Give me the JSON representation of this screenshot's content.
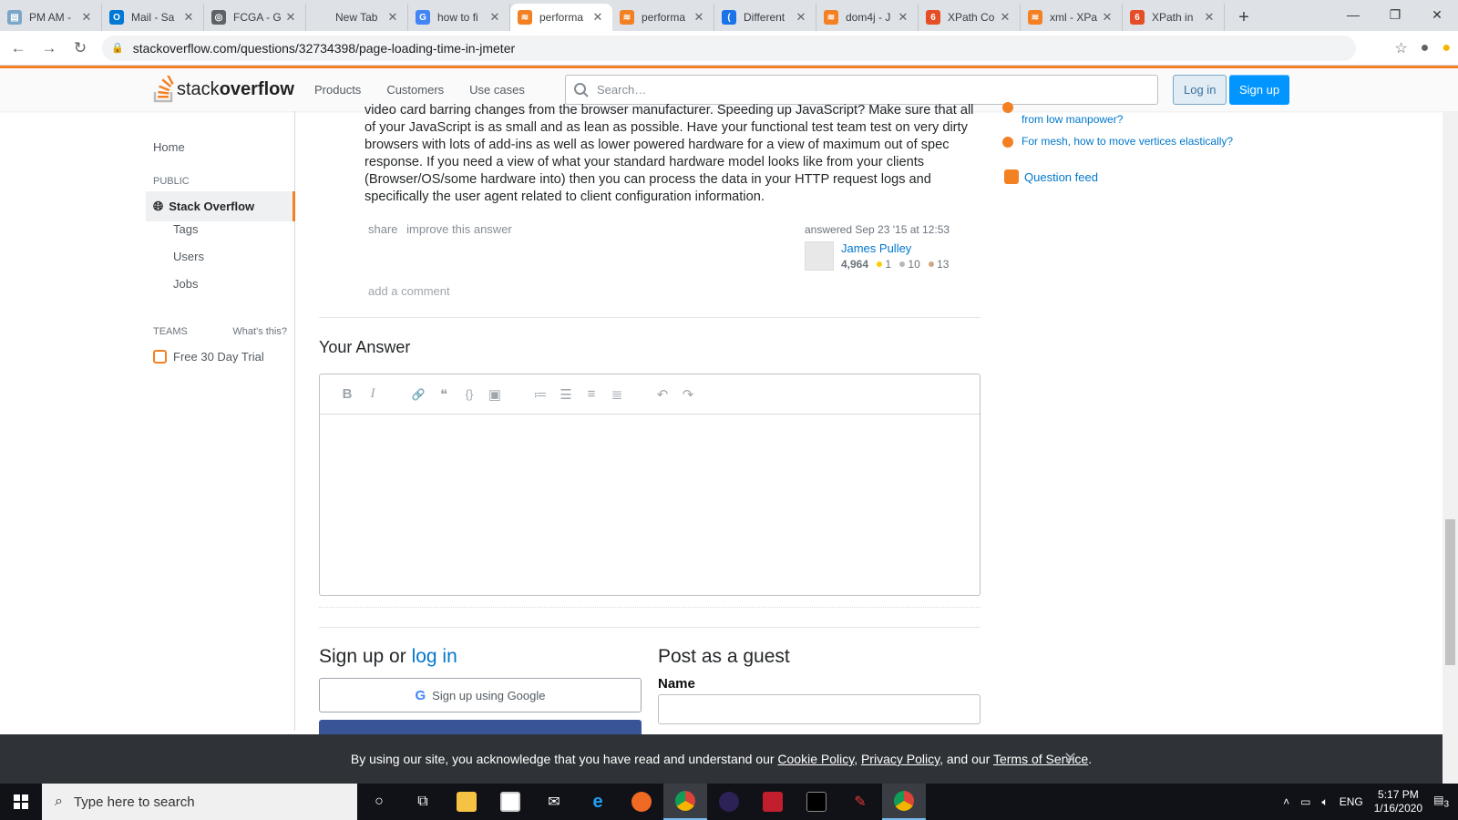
{
  "browser": {
    "tabs": [
      {
        "title": "PM AM -",
        "color": "#7aa7c7",
        "glyph": "▤"
      },
      {
        "title": "Mail - Sa",
        "color": "#0078d4",
        "glyph": "O"
      },
      {
        "title": "FCGA - G",
        "color": "#5f6368",
        "glyph": "◎"
      },
      {
        "title": "New Tab",
        "color": "",
        "glyph": ""
      },
      {
        "title": "how to fi",
        "color": "#4285f4",
        "glyph": "G"
      },
      {
        "title": "performa",
        "color": "#f48024",
        "glyph": "≋",
        "active": true
      },
      {
        "title": "performa",
        "color": "#f48024",
        "glyph": "≋"
      },
      {
        "title": "Different",
        "color": "#1a73e8",
        "glyph": "("
      },
      {
        "title": "dom4j - J",
        "color": "#f48024",
        "glyph": "≋"
      },
      {
        "title": "XPath Co",
        "color": "#e44d26",
        "glyph": "6"
      },
      {
        "title": "xml - XPa",
        "color": "#f48024",
        "glyph": "≋"
      },
      {
        "title": "XPath in",
        "color": "#e44d26",
        "glyph": "6"
      }
    ],
    "new_tab_glyph": "+",
    "window_controls": {
      "minimize": "—",
      "restore": "❐",
      "close": "✕"
    },
    "url": "stackoverflow.com/questions/32734398/page-loading-time-in-jmeter"
  },
  "so_header": {
    "logo_stack": "stack",
    "logo_overflow": "overflow",
    "nav": [
      "Products",
      "Customers",
      "Use cases"
    ],
    "search_placeholder": "Search…",
    "login": "Log in",
    "signup": "Sign up"
  },
  "left_nav": {
    "home": "Home",
    "public": "PUBLIC",
    "stack_overflow": "Stack Overflow",
    "tags": "Tags",
    "users": "Users",
    "jobs": "Jobs",
    "teams": "TEAMS",
    "whats_this": "What's this?",
    "free_trial": "Free 30 Day Trial"
  },
  "answer": {
    "body": "video card barring changes from the browser manufacturer. Speeding up JavaScript? Make sure that all of your JavaScript is as small and as lean as possible. Have your functional test team test on very dirty browsers with lots of add-ins as well as lower powered hardware for a view of maximum out of spec response. If you need a view of what your standard hardware model looks like from your clients (Browser/OS/some hardware into) then you can process the data in your HTTP request logs and specifically the user agent related to client configuration information.",
    "share": "share",
    "improve": "improve this answer",
    "answered": "answered Sep 23 '15 at 12:53",
    "user": "James Pulley",
    "rep": "4,964",
    "gold": "1",
    "silver": "10",
    "bronze": "13",
    "add_comment": "add a comment"
  },
  "your_answer": {
    "heading": "Your Answer",
    "toolbar": [
      "B",
      "I",
      "🔗",
      "❝",
      "{}",
      "▣",
      "≔",
      "☰",
      "≡",
      "≣",
      "↶",
      "↷"
    ]
  },
  "signup": {
    "heading_text": "Sign up or ",
    "heading_link": "log in",
    "google": "Sign up using Google",
    "guest_heading": "Post as a guest",
    "name_label": "Name"
  },
  "sidebar": {
    "hot1": "from low manpower?",
    "hot2": "For mesh, how to move vertices elastically?",
    "feed": "Question feed"
  },
  "cookie": {
    "prefix": "By using our site, you acknowledge that you have read and understand our ",
    "cookie_policy": "Cookie Policy",
    "sep1": ", ",
    "privacy_policy": "Privacy Policy",
    "sep2": ", and our ",
    "terms": "Terms of Service",
    "suffix": ".",
    "close": "✕"
  },
  "taskbar": {
    "search_placeholder": "Type here to search",
    "lang": "ENG",
    "time": "5:17 PM",
    "date": "1/16/2020",
    "notifications": "3"
  }
}
